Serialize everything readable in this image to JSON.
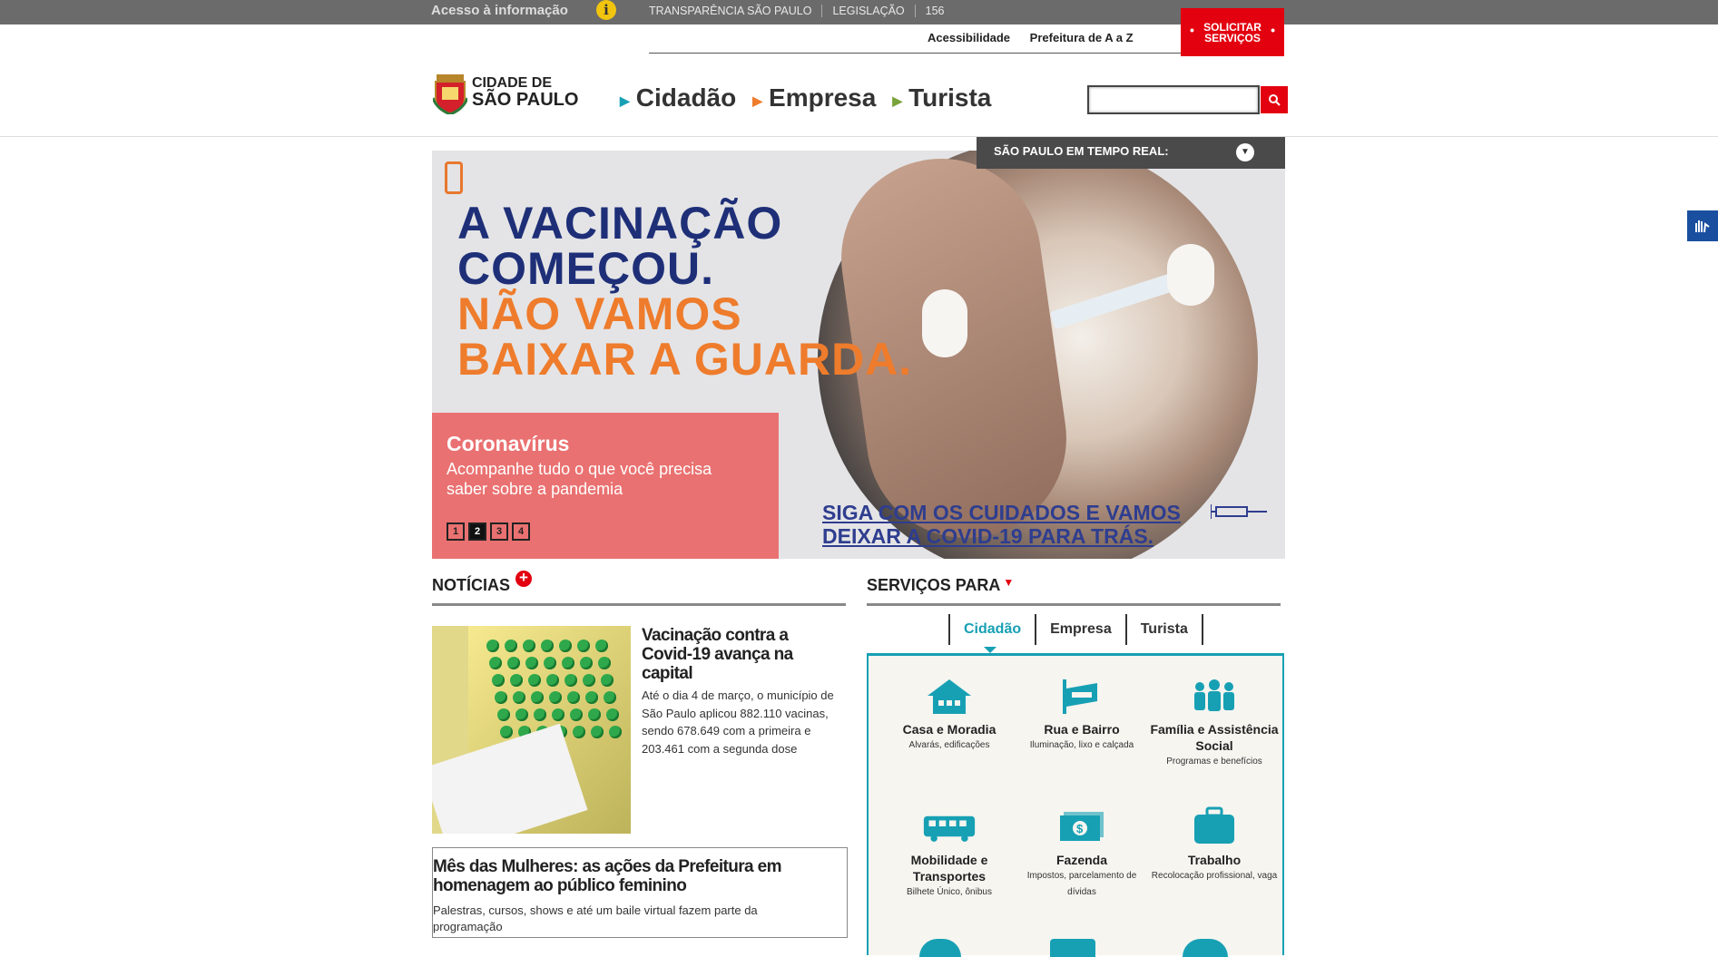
{
  "topbar": {
    "acesso": "Acesso à informação",
    "links": [
      "TRANSPARÊNCIA SÃO PAULO",
      "LEGISLAÇÃO",
      "156"
    ],
    "solicitar": "SOLICITAR SERVIÇOS",
    "sublinks": [
      "Acessibilidade",
      "Prefeitura de A a Z"
    ]
  },
  "header": {
    "logo_line1": "CIDADE DE",
    "logo_line2": "SÃO PAULO",
    "nav": [
      "Cidadão",
      "Empresa",
      "Turista"
    ],
    "nav_arrow_colors": [
      "#17a0b4",
      "#ee7c2c",
      "#7aa33b"
    ],
    "search_placeholder": ""
  },
  "banner": {
    "realtime": "SÃO PAULO EM TEMPO REAL:",
    "line1": "A VACINAÇÃO",
    "line2": "COMEÇOU.",
    "line3": "NÃO VAMOS",
    "line4": "BAIXAR A GUARDA.",
    "siga1": "SIGA COM OS CUIDADOS E VAMOS",
    "siga2": "DEIXAR A COVID-19 PARA TRÁS.",
    "caption_title": "Coronavírus",
    "caption_text": "Acompanhe tudo o que você precisa saber sobre a pandemia",
    "pages": [
      "1",
      "2",
      "3",
      "4"
    ],
    "active_page": "2"
  },
  "news": {
    "title": "NOTÍCIAS",
    "item1_title": "Vacinação contra a Covid-19 avança na capital",
    "item1_desc": "Até o dia 4 de março, o município de São Paulo aplicou 882.110 vacinas, sendo 678.649 com a primeira e 203.461 com a segunda dose",
    "item2_title": "Mês das Mulheres: as ações da Prefeitura em homenagem ao público feminino",
    "item2_desc": "Palestras, cursos, shows e até um baile virtual fazem parte da programação"
  },
  "services": {
    "title": "SERVIÇOS PARA",
    "tabs": [
      "Cidadão",
      "Empresa",
      "Turista"
    ],
    "items": [
      {
        "name": "Casa e Moradia",
        "desc": "Alvarás, edificações",
        "icon": "house-icon"
      },
      {
        "name": "Rua e Bairro",
        "desc": "Iluminação, lixo e calçada",
        "icon": "street-sign-icon"
      },
      {
        "name": "Família e Assistência Social",
        "desc": "Programas e benefícios",
        "icon": "family-icon"
      },
      {
        "name": "Mobilidade e Transportes",
        "desc": "Bilhete Único, ônibus",
        "icon": "bus-icon"
      },
      {
        "name": "Fazenda",
        "desc": "Impostos, parcelamento de dívidas",
        "icon": "money-icon"
      },
      {
        "name": "Trabalho",
        "desc": "Recolocação profissional, vaga",
        "icon": "briefcase-icon"
      }
    ]
  },
  "colors": {
    "red": "#e3000f",
    "teal": "#17a0b4",
    "navy": "#1e2f78",
    "orange": "#ee7c2c"
  }
}
